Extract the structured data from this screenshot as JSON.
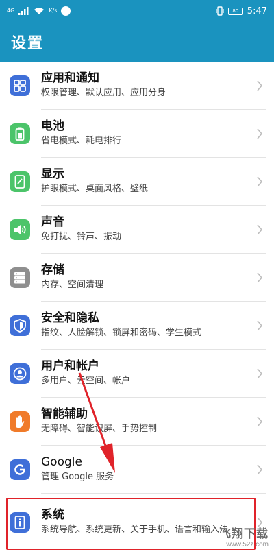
{
  "status_bar": {
    "signal_label": "4G",
    "speed": "K/s",
    "battery": "80",
    "time": "5:47"
  },
  "app_bar": {
    "title": "设置"
  },
  "items": [
    {
      "id": "apps",
      "title": "应用和通知",
      "subtitle": "权限管理、默认应用、应用分身",
      "icon": "apps-grid-icon",
      "color": "#3f6fd8"
    },
    {
      "id": "battery",
      "title": "电池",
      "subtitle": "省电模式、耗电排行",
      "icon": "battery-icon",
      "color": "#4cc46a"
    },
    {
      "id": "display",
      "title": "显示",
      "subtitle": "护眼模式、桌面风格、壁纸",
      "icon": "display-icon",
      "color": "#4cc46a"
    },
    {
      "id": "sound",
      "title": "声音",
      "subtitle": "免打扰、铃声、振动",
      "icon": "speaker-icon",
      "color": "#4cc46a"
    },
    {
      "id": "storage",
      "title": "存储",
      "subtitle": "内存、空间清理",
      "icon": "storage-icon",
      "color": "#8f8f8f"
    },
    {
      "id": "security",
      "title": "安全和隐私",
      "subtitle": "指纹、人脸解锁、锁屏和密码、学生模式",
      "icon": "shield-icon",
      "color": "#3f6fd8"
    },
    {
      "id": "accounts",
      "title": "用户和帐户",
      "subtitle": "多用户、云空间、帐户",
      "icon": "user-icon",
      "color": "#3f6fd8"
    },
    {
      "id": "accessibility",
      "title": "智能辅助",
      "subtitle": "无障碍、智能识屏、手势控制",
      "icon": "hand-icon",
      "color": "#f07b2a"
    },
    {
      "id": "google",
      "title": "Google",
      "subtitle": "管理 Google 服务",
      "icon": "google-icon",
      "color": "#3f6fd8"
    },
    {
      "id": "system",
      "title": "系统",
      "subtitle": "系统导航、系统更新、关于手机、语言和输入法",
      "icon": "info-icon",
      "color": "#3f6fd8"
    }
  ],
  "watermark": {
    "big": "飞翔下载",
    "small": "www.52z.com"
  }
}
